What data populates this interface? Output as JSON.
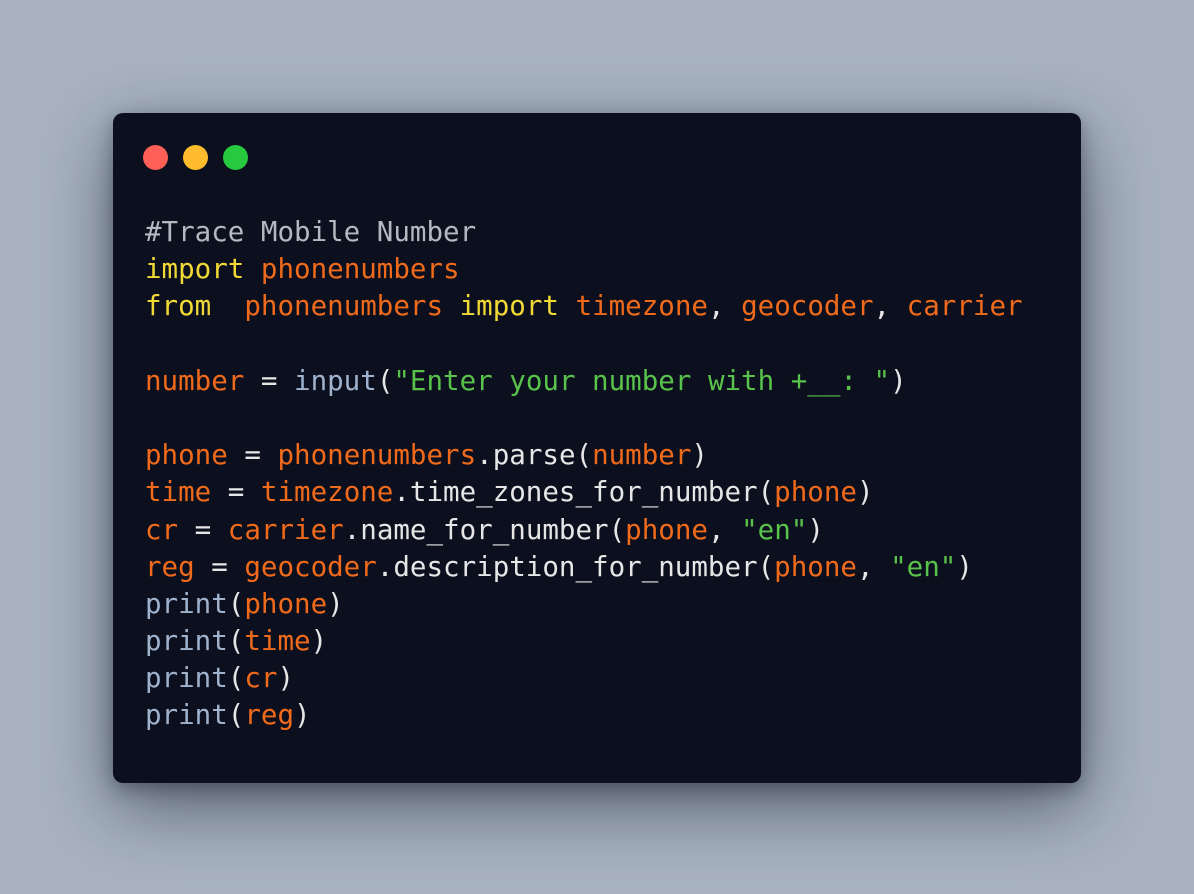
{
  "window": {
    "buttons": [
      {
        "name": "close-button",
        "color": "#ff5f56"
      },
      {
        "name": "minimize-button",
        "color": "#ffbd2e"
      },
      {
        "name": "maximize-button",
        "color": "#27c93f"
      }
    ]
  },
  "colors": {
    "comment": "#b4b8c0",
    "keyword": "#f1d935",
    "identifier": "#ef6a1a",
    "plain": "#e6e6e6",
    "builtin": "#9fb2ce",
    "string": "#58c24a"
  },
  "code": {
    "lines": [
      [
        {
          "t": "#Trace Mobile Number",
          "c": "comment"
        }
      ],
      [
        {
          "t": "import",
          "c": "keyword"
        },
        {
          "t": " ",
          "c": "plain"
        },
        {
          "t": "phonenumbers",
          "c": "identifier"
        }
      ],
      [
        {
          "t": "from",
          "c": "keyword"
        },
        {
          "t": "  ",
          "c": "plain"
        },
        {
          "t": "phonenumbers",
          "c": "identifier"
        },
        {
          "t": " ",
          "c": "plain"
        },
        {
          "t": "import",
          "c": "keyword"
        },
        {
          "t": " ",
          "c": "plain"
        },
        {
          "t": "timezone",
          "c": "identifier"
        },
        {
          "t": ", ",
          "c": "plain"
        },
        {
          "t": "geocoder",
          "c": "identifier"
        },
        {
          "t": ", ",
          "c": "plain"
        },
        {
          "t": "carrier",
          "c": "identifier"
        }
      ],
      [],
      [
        {
          "t": "number",
          "c": "identifier"
        },
        {
          "t": " = ",
          "c": "plain"
        },
        {
          "t": "input",
          "c": "builtin"
        },
        {
          "t": "(",
          "c": "plain"
        },
        {
          "t": "\"Enter your number with +__: \"",
          "c": "string"
        },
        {
          "t": ")",
          "c": "plain"
        }
      ],
      [],
      [
        {
          "t": "phone",
          "c": "identifier"
        },
        {
          "t": " = ",
          "c": "plain"
        },
        {
          "t": "phonenumbers",
          "c": "identifier"
        },
        {
          "t": ".parse(",
          "c": "plain"
        },
        {
          "t": "number",
          "c": "identifier"
        },
        {
          "t": ")",
          "c": "plain"
        }
      ],
      [
        {
          "t": "time",
          "c": "identifier"
        },
        {
          "t": " = ",
          "c": "plain"
        },
        {
          "t": "timezone",
          "c": "identifier"
        },
        {
          "t": ".time_zones_for_number(",
          "c": "plain"
        },
        {
          "t": "phone",
          "c": "identifier"
        },
        {
          "t": ")",
          "c": "plain"
        }
      ],
      [
        {
          "t": "cr",
          "c": "identifier"
        },
        {
          "t": " = ",
          "c": "plain"
        },
        {
          "t": "carrier",
          "c": "identifier"
        },
        {
          "t": ".name_for_number(",
          "c": "plain"
        },
        {
          "t": "phone",
          "c": "identifier"
        },
        {
          "t": ", ",
          "c": "plain"
        },
        {
          "t": "\"en\"",
          "c": "string"
        },
        {
          "t": ")",
          "c": "plain"
        }
      ],
      [
        {
          "t": "reg",
          "c": "identifier"
        },
        {
          "t": " = ",
          "c": "plain"
        },
        {
          "t": "geocoder",
          "c": "identifier"
        },
        {
          "t": ".description_for_number(",
          "c": "plain"
        },
        {
          "t": "phone",
          "c": "identifier"
        },
        {
          "t": ", ",
          "c": "plain"
        },
        {
          "t": "\"en\"",
          "c": "string"
        },
        {
          "t": ")",
          "c": "plain"
        }
      ],
      [
        {
          "t": "print",
          "c": "builtin"
        },
        {
          "t": "(",
          "c": "plain"
        },
        {
          "t": "phone",
          "c": "identifier"
        },
        {
          "t": ")",
          "c": "plain"
        }
      ],
      [
        {
          "t": "print",
          "c": "builtin"
        },
        {
          "t": "(",
          "c": "plain"
        },
        {
          "t": "time",
          "c": "identifier"
        },
        {
          "t": ")",
          "c": "plain"
        }
      ],
      [
        {
          "t": "print",
          "c": "builtin"
        },
        {
          "t": "(",
          "c": "plain"
        },
        {
          "t": "cr",
          "c": "identifier"
        },
        {
          "t": ")",
          "c": "plain"
        }
      ],
      [
        {
          "t": "print",
          "c": "builtin"
        },
        {
          "t": "(",
          "c": "plain"
        },
        {
          "t": "reg",
          "c": "identifier"
        },
        {
          "t": ")",
          "c": "plain"
        }
      ]
    ]
  }
}
